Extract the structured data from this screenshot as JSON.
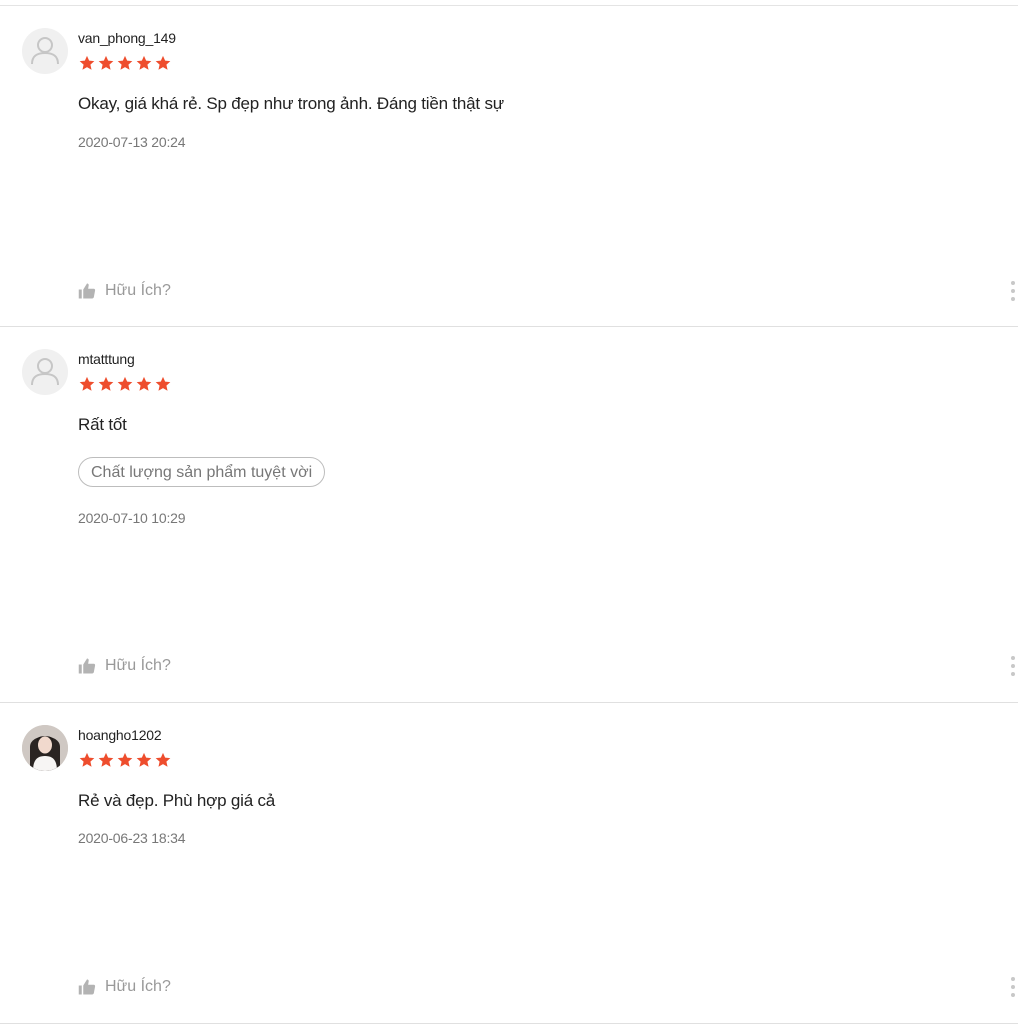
{
  "reviews": [
    {
      "username": "van_phong_149",
      "rating": 5,
      "avatar": "default-user-icon",
      "comment": "Okay, giá khá rẻ. Sp đẹp như trong ảnh. Đáng tiền thật sự",
      "tags": [],
      "timestamp": "2020-07-13 20:24",
      "helpful_label": "Hữu Ích?"
    },
    {
      "username": "mtatttung",
      "rating": 5,
      "avatar": "default-user-icon",
      "comment": "Rất tốt",
      "tags": [
        "Chất lượng sản phẩm tuyệt vời"
      ],
      "timestamp": "2020-07-10 10:29",
      "helpful_label": "Hữu Ích?"
    },
    {
      "username": "hoangho1202",
      "rating": 5,
      "avatar": "user-photo",
      "comment": "Rẻ và đẹp.  Phù hợp giá cả",
      "tags": [],
      "timestamp": "2020-06-23 18:34",
      "helpful_label": "Hữu Ích?"
    }
  ],
  "colors": {
    "star": "#ee4d2d",
    "divider": "#e0e0e0",
    "muted_text": "#999999"
  }
}
